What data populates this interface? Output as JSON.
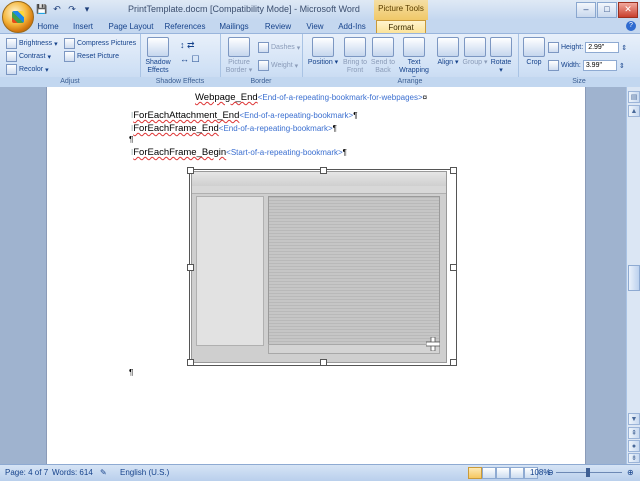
{
  "window": {
    "title": "PrintTemplate.docm [Compatibility Mode] - Microsoft Word",
    "context_tab_group": "Picture Tools",
    "minimize": "–",
    "maximize": "□",
    "close": "✕"
  },
  "qat": {
    "save": "💾",
    "undo": "↶",
    "redo": "↷",
    "customize": "▾"
  },
  "tabs": [
    "Home",
    "Insert",
    "Page Layout",
    "References",
    "Mailings",
    "Review",
    "View",
    "Add-Ins",
    "Format"
  ],
  "ribbon": {
    "adjust": {
      "label": "Adjust",
      "brightness": "Brightness",
      "contrast": "Contrast",
      "recolor": "Recolor",
      "compress": "Compress Pictures",
      "reset": "Reset Picture"
    },
    "shadow": {
      "label": "Shadow Effects",
      "button": "Shadow Effects"
    },
    "border": {
      "label": "Border",
      "picture_border": "Picture Border",
      "dashes": "Dashes",
      "weight": "Weight"
    },
    "arrange": {
      "label": "Arrange",
      "position": "Position",
      "bring_to_front": "Bring to Front",
      "send_to_back": "Send to Back",
      "text_wrapping": "Text Wrapping",
      "align": "Align",
      "group": "Group",
      "rotate": "Rotate"
    },
    "size": {
      "label": "Size",
      "crop": "Crop",
      "height_label": "Height:",
      "height": "2.99\"",
      "width_label": "Width:",
      "width": "3.99\""
    }
  },
  "document": {
    "lines": [
      {
        "marker": "",
        "name": "Webpage_End",
        "comment": "<End-of-a-repeating-bookmark-for-webpages>",
        "end": "¤"
      },
      {
        "marker": "I",
        "name": "ForEachAttachment_End",
        "comment": "<End-of-a-repeating-bookmark>",
        "end": "¶"
      },
      {
        "marker": "I",
        "name": "ForEachFrame_End",
        "comment": "<End-of-a-repeating-bookmark>",
        "end": "¶"
      },
      {
        "marker": "",
        "name": "",
        "comment": "",
        "end": "¶"
      },
      {
        "marker": "I",
        "name": "ForEachFrame_Begin",
        "comment": "<Start-of-a-repeating-bookmark>",
        "end": "¶"
      }
    ],
    "after_picture_mark": "¶"
  },
  "statusbar": {
    "page": "Page: 4 of 7",
    "words": "Words: 614",
    "language": "English (U.S.)",
    "zoom": "108%"
  }
}
